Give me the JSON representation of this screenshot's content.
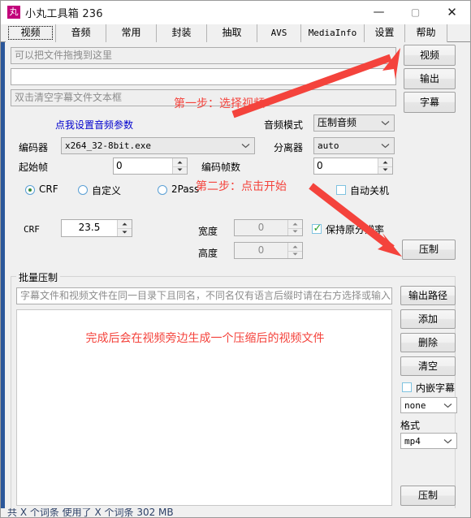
{
  "window": {
    "title": "小丸工具箱 236",
    "icon_glyph": "丸",
    "icon_color": "#c2007b",
    "minimize_glyph": "—",
    "maximize_glyph": "▢",
    "close_glyph": "✕"
  },
  "tabs": [
    {
      "label": "视频",
      "selected": true
    },
    {
      "label": "音频",
      "selected": false
    },
    {
      "label": "常用",
      "selected": false
    },
    {
      "label": "封装",
      "selected": false
    },
    {
      "label": "抽取",
      "selected": false
    },
    {
      "label": "AVS",
      "selected": false
    },
    {
      "label": "MediaInfo",
      "selected": false
    },
    {
      "label": "设置",
      "selected": false
    },
    {
      "label": "帮助",
      "selected": false
    }
  ],
  "video_tab": {
    "input_video_placeholder": "可以把文件拖拽到这里",
    "output_value": "",
    "subtitle_placeholder": "双击清空字幕文件文本框",
    "btn_video": "视频",
    "btn_output": "输出",
    "btn_subtitle": "字幕",
    "audio_param_link": "点我设置音频参数",
    "label_audio_mode": "音频模式",
    "audio_mode_value": "压制音频",
    "label_encoder": "编码器",
    "encoder_value": "x264_32-8bit.exe",
    "label_demuxer": "分离器",
    "demuxer_value": "auto",
    "label_start_frame": "起始帧",
    "start_frame_value": "0",
    "label_frame_count": "编码帧数",
    "frame_count_value": "0",
    "radio_crf": "CRF",
    "radio_custom": "自定义",
    "radio_2pass": "2Pass",
    "check_auto_shutdown": "自动关机",
    "label_crf": "CRF",
    "crf_value": "23.5",
    "label_width": "宽度",
    "width_value": "0",
    "label_height": "高度",
    "height_value": "0",
    "check_keep_resolution": "保持原分辨率",
    "btn_encode": "压制"
  },
  "batch": {
    "group_title": "批量压制",
    "path_placeholder": "字幕文件和视频文件在同一目录下且同名，不同名仅有语言后缀时请在右方选择或输入",
    "btn_output_path": "输出路径",
    "btn_add": "添加",
    "btn_delete": "删除",
    "btn_clear": "清空",
    "check_embed_subtitle": "内嵌字幕",
    "subtitle_lang_value": "none",
    "label_format": "格式",
    "format_value": "mp4",
    "btn_batch_encode": "压制",
    "list_note": "完成后会在视频旁边生成一个压缩后的视频文件"
  },
  "annotations": {
    "step1": "第一步：选择视频",
    "step2": "第二步：点击开始",
    "color": "#f4433c"
  },
  "statusbar": {
    "text": "共 X 个词条  使用了 X 个词条  302 MB"
  }
}
